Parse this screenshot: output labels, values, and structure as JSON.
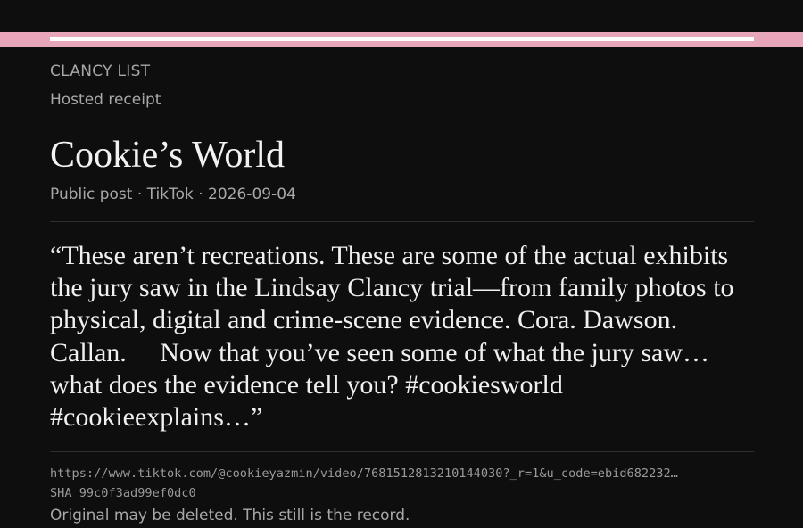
{
  "app": {
    "brand": "CLANCY LIST",
    "subtitle": "Hosted receipt"
  },
  "post": {
    "title": "Cookie’s World",
    "visibility": "Public post",
    "platform": "TikTok",
    "date": "2026-09-04",
    "separator": "·",
    "quote": "“These aren’t recreations. These are some of the actual exhibits the jury saw in the Lindsay Clancy trial—from family photos to physical, digital and crime-scene evidence. Cora. Dawson. Callan.     Now that you’ve seen some of what the jury saw… what does the evidence tell you? #cookiesworld #cookieexplains…”"
  },
  "receipt": {
    "url": "https://www.tiktok.com/@cookieyazmin/video/7681512813210144030?_r=1&u_code=ebid682232…",
    "sha": "SHA 99c0f3ad99ef0dc0",
    "note": "Original may be deleted. This still is the record."
  },
  "colors": {
    "accent_bar": "#e8a6ba",
    "background": "#0e0e0e"
  }
}
